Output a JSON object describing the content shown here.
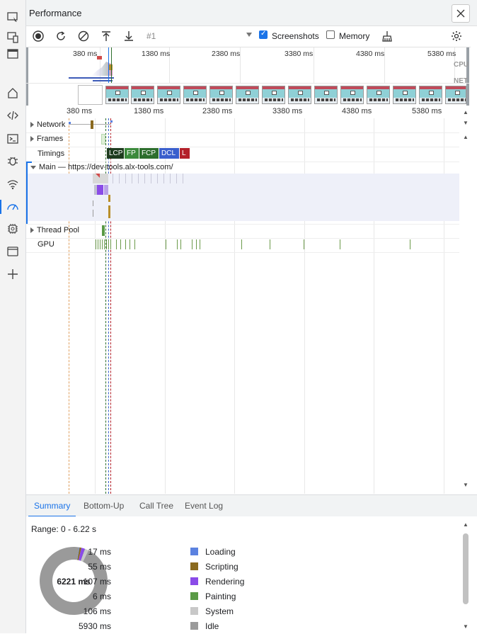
{
  "activity_bar": {
    "icons": [
      "inspect-icon",
      "device-toggle-icon",
      "dock-icon",
      "home-icon",
      "elements-icon",
      "console-icon",
      "sources-bug-icon",
      "network-wifi-icon",
      "performance-icon",
      "memory-chip-icon",
      "application-icon",
      "more-tools-icon"
    ]
  },
  "header": {
    "title": "Performance",
    "close_icon": "close-icon"
  },
  "toolbar": {
    "record_icon": "record-icon",
    "reload_icon": "reload-icon",
    "clear_icon": "clear-icon",
    "upload_icon": "upload-icon",
    "download_icon": "download-icon",
    "recording_label": "#1",
    "screenshots_label": "Screenshots",
    "screenshots_checked": true,
    "memory_label": "Memory",
    "memory_checked": false,
    "gc_icon": "broom-icon",
    "settings_icon": "gear-icon"
  },
  "overview": {
    "ticks": [
      "380 ms",
      "1380 ms",
      "2380 ms",
      "3380 ms",
      "4380 ms",
      "5380 ms"
    ],
    "cpu_label": "CPU",
    "net_label": "NET"
  },
  "ruler": {
    "ticks": [
      "380 ms",
      "1380 ms",
      "2380 ms",
      "3380 ms",
      "4380 ms",
      "5380 ms"
    ]
  },
  "tracks": {
    "network": "Network",
    "frames": "Frames",
    "timings": "Timings",
    "timing_markers": [
      {
        "label": "LCP",
        "color": "#1e3b1e"
      },
      {
        "label": "FP",
        "color": "#3c8a3c"
      },
      {
        "label": "FCP",
        "color": "#2d6e2d"
      },
      {
        "label": "DCL",
        "color": "#3a5fcd"
      },
      {
        "label": "L",
        "color": "#b3202a"
      }
    ],
    "main": "Main — https://dev-tools.alx-tools.com/",
    "thread_pool": "Thread Pool",
    "gpu": "GPU"
  },
  "bottom_tabs": [
    "Summary",
    "Bottom-Up",
    "Call Tree",
    "Event Log"
  ],
  "summary": {
    "range": "Range: 0 - 6.22 s",
    "total": "6221 ms",
    "items": [
      {
        "value": "17 ms",
        "name": "Loading",
        "color": "#5b82e0",
        "amount": 17
      },
      {
        "value": "55 ms",
        "name": "Scripting",
        "color": "#8a6a1f",
        "amount": 55
      },
      {
        "value": "107 ms",
        "name": "Rendering",
        "color": "#8a4be8",
        "amount": 107
      },
      {
        "value": "6 ms",
        "name": "Painting",
        "color": "#5a9a46",
        "amount": 6
      },
      {
        "value": "106 ms",
        "name": "System",
        "color": "#c8c8c8",
        "amount": 106
      },
      {
        "value": "5930 ms",
        "name": "Idle",
        "color": "#9a9a9a",
        "amount": 5930
      }
    ]
  }
}
